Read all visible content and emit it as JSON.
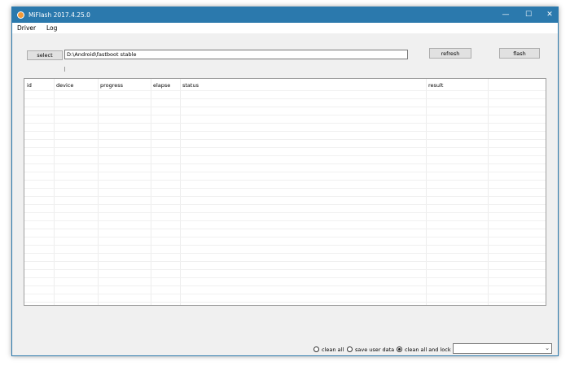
{
  "window": {
    "title": "MiFlash 2017.4.25.0",
    "controls": {
      "minimize": "—",
      "maximize": "☐",
      "close": "✕"
    }
  },
  "menu": {
    "items": [
      "Driver",
      "Log"
    ]
  },
  "toolbar": {
    "select_label": "select",
    "path_value": "D:\\Android\\fastboot stable",
    "refresh_label": "refresh",
    "flash_label": "flash"
  },
  "table": {
    "columns": [
      "id",
      "device",
      "progress",
      "elapse",
      "status",
      "result"
    ],
    "rows": []
  },
  "options": {
    "radios": [
      {
        "label": "clean all",
        "checked": false
      },
      {
        "label": "save user data",
        "checked": false
      },
      {
        "label": "clean all and lock",
        "checked": true
      }
    ],
    "combo_value": "",
    "combo_arrow": "⌄"
  },
  "colors": {
    "titlebar": "#2b79ad",
    "app_icon": "#f39a38"
  },
  "icons": {
    "app": "miflash-app-icon"
  }
}
